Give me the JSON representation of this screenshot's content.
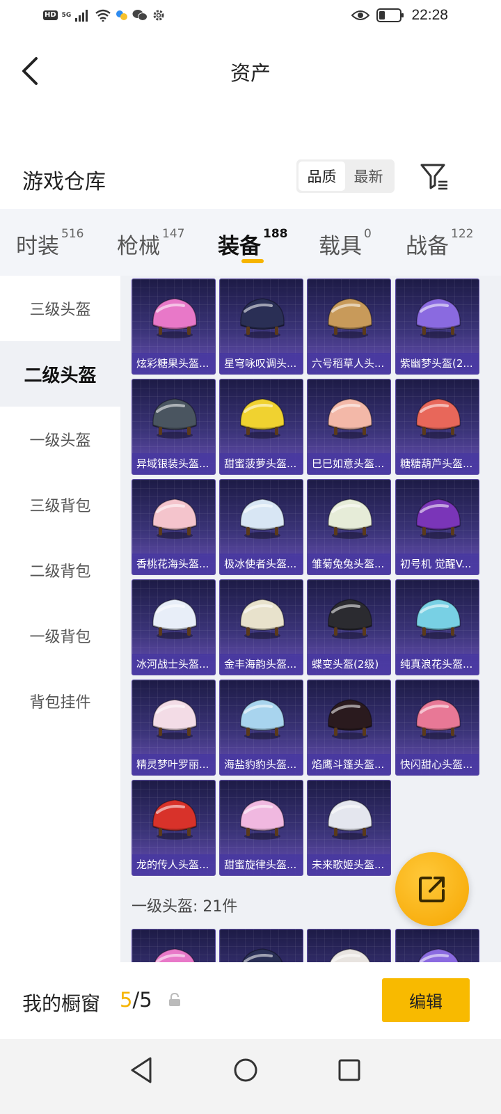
{
  "status_bar": {
    "hd": "HD",
    "network": "5G",
    "time": "22:28"
  },
  "header": {
    "title": "资产"
  },
  "warehouse": {
    "title": "游戏仓库",
    "sort_options": [
      "品质",
      "最新"
    ],
    "active_sort": "品质"
  },
  "categories": [
    {
      "label": "时装",
      "count": "516"
    },
    {
      "label": "枪械",
      "count": "147"
    },
    {
      "label": "装备",
      "count": "188"
    },
    {
      "label": "载具",
      "count": "0"
    },
    {
      "label": "战备",
      "count": "122"
    }
  ],
  "active_category": "装备",
  "sidebar": {
    "items": [
      "三级头盔",
      "二级头盔",
      "一级头盔",
      "三级背包",
      "二级背包",
      "一级背包",
      "背包挂件"
    ],
    "active": "二级头盔"
  },
  "items": [
    {
      "name": "炫彩糖果头盔...",
      "color": "#e878c8"
    },
    {
      "name": "星穹咏叹调头...",
      "color": "#2a2f55"
    },
    {
      "name": "六号稻草人头...",
      "color": "#c89a5a"
    },
    {
      "name": "紫幽梦头盔(2...",
      "color": "#8a6ae0"
    },
    {
      "name": "异域银装头盔...",
      "color": "#4a5560"
    },
    {
      "name": "甜蜜菠萝头盔...",
      "color": "#f0d230"
    },
    {
      "name": "巳巳如意头盔...",
      "color": "#f3b8a8"
    },
    {
      "name": "糖糖葫芦头盔...",
      "color": "#e8675a"
    },
    {
      "name": "香桃花海头盔...",
      "color": "#f4c4cc"
    },
    {
      "name": "极冰使者头盔...",
      "color": "#d8e6f4"
    },
    {
      "name": "雏菊兔兔头盔...",
      "color": "#e6ecd8"
    },
    {
      "name": "初号机 觉醒V...",
      "color": "#7a35b8"
    },
    {
      "name": "冰河战士头盔...",
      "color": "#e8eef8"
    },
    {
      "name": "金丰海韵头盔...",
      "color": "#e8e2cc"
    },
    {
      "name": "蝶变头盔(2级)",
      "color": "#2b2b30"
    },
    {
      "name": "纯真浪花头盔...",
      "color": "#78d0e4"
    },
    {
      "name": "精灵梦叶罗丽...",
      "color": "#f3dce6"
    },
    {
      "name": "海盐豹豹头盔...",
      "color": "#a8d4ee"
    },
    {
      "name": "焰鹰斗篷头盔...",
      "color": "#2a1a1e"
    },
    {
      "name": "快闪甜心头盔...",
      "color": "#e87896"
    },
    {
      "name": "龙的传人头盔...",
      "color": "#d8322a"
    },
    {
      "name": "甜蜜旋律头盔...",
      "color": "#f0b8e0"
    },
    {
      "name": "未来歌姬头盔...",
      "color": "#e4e6ee"
    }
  ],
  "section_label": "一级头盔: 21件",
  "partial_items": [
    {
      "color": "#e878c8"
    },
    {
      "color": "#2a2f55"
    },
    {
      "color": "#e8e4e0"
    },
    {
      "color": "#8a6ae0"
    }
  ],
  "bottom": {
    "window_label": "我的橱窗",
    "window_current": "5",
    "window_total": "/5",
    "edit_label": "编辑"
  },
  "colors": {
    "accent": "#f6b400",
    "card_bg": "#3b3479",
    "caption_bg": "#4637a0"
  }
}
